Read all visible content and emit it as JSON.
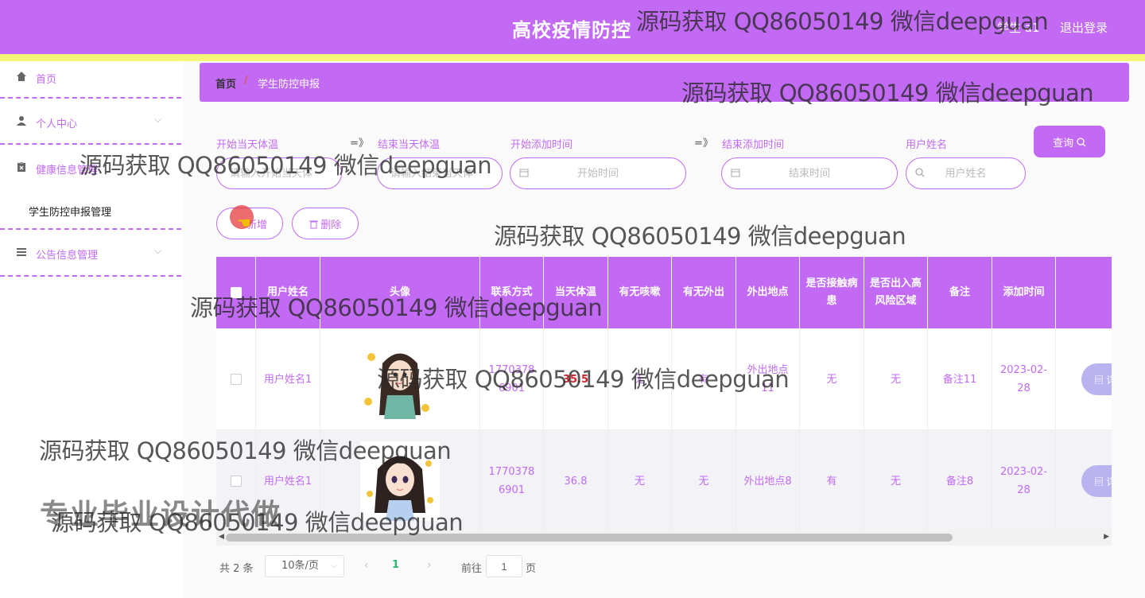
{
  "header": {
    "title": "高校疫情防控",
    "user": "学生 a1",
    "logout": "退出登录"
  },
  "sidebar": {
    "home": "首页",
    "personal": "个人中心",
    "health": "健康信息管理",
    "health_sub": "学生防控申报管理",
    "notice": "公告信息管理"
  },
  "breadcrumb": {
    "home": "首页",
    "sep": "/",
    "current": "学生防控申报"
  },
  "search": {
    "temp_start_label": "开始当天体温",
    "temp_end_label": "结束当天体温",
    "time_start_label": "开始添加时间",
    "time_end_label": "结束添加时间",
    "username_label": "用户姓名",
    "arrow": "=》",
    "temp_start_placeholder": "请输入开始当天体",
    "temp_end_placeholder": "请输入结束当天体",
    "time_start_placeholder": "开始时间",
    "time_end_placeholder": "结束时间",
    "username_placeholder": "用户姓名",
    "query_button": "查询"
  },
  "actions": {
    "add": "新增",
    "delete": "删除"
  },
  "table": {
    "headers": [
      "用户姓名",
      "头像",
      "联系方式",
      "当天体温",
      "有无咳嗽",
      "有无外出",
      "外出地点",
      "是否接触病患",
      "是否出入高风险区域",
      "备注",
      "添加时间"
    ],
    "detail_button": "详情",
    "rows": [
      {
        "username": "用户姓名1",
        "phone": "17703786901",
        "temp": "35.5",
        "cough": "无",
        "out": "有",
        "place": "外出地点11",
        "contact": "无",
        "risk_area": "无",
        "note": "备注11",
        "added": "2023-02-28"
      },
      {
        "username": "用户姓名1",
        "phone": "17703786901",
        "temp": "36.8",
        "cough": "无",
        "out": "无",
        "place": "外出地点8",
        "contact": "有",
        "risk_area": "无",
        "note": "备注8",
        "added": "2023-02-28"
      }
    ]
  },
  "pagination": {
    "total": "共 2 条",
    "page_size": "10条/页",
    "current": "1",
    "goto": "前往",
    "goto_value": "1",
    "page_unit": "页"
  },
  "watermark": {
    "text": "源码获取 QQ86050149 微信deepguan",
    "big": "专业毕业设计代做"
  },
  "colors": {
    "primary": "#c26af4",
    "yellow": "#f5f577",
    "danger": "#d0202a",
    "detail": "#b9b4f0"
  }
}
